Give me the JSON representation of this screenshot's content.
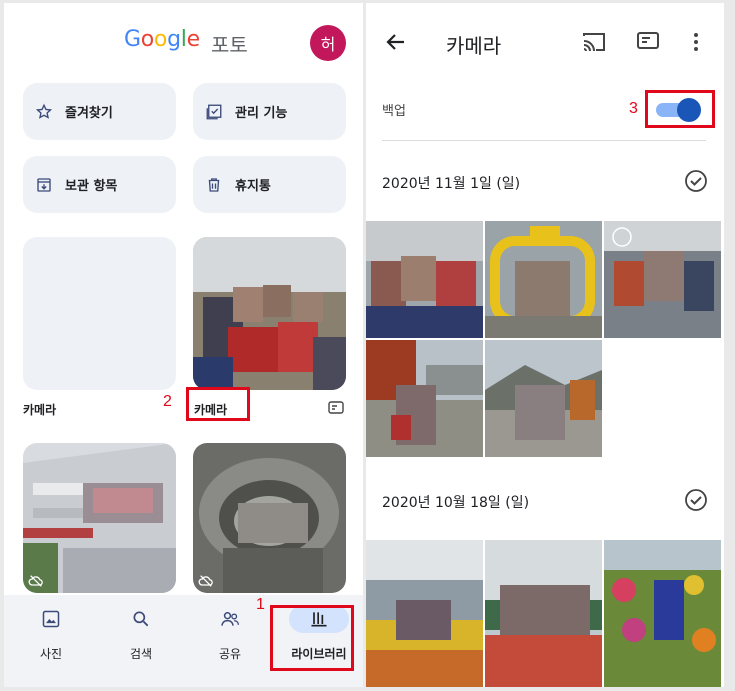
{
  "left": {
    "logo_letters": [
      "G",
      "o",
      "o",
      "g",
      "l",
      "e"
    ],
    "logo_suffix": "포토",
    "avatar_initial": "허",
    "quick_buttons": [
      {
        "label": "즐겨찾기",
        "icon": "star-icon"
      },
      {
        "label": "관리 기능",
        "icon": "checklist-icon"
      },
      {
        "label": "보관 항목",
        "icon": "archive-icon"
      },
      {
        "label": "휴지통",
        "icon": "trash-icon"
      }
    ],
    "albums": [
      {
        "label": "카메라"
      },
      {
        "label": "카메라"
      }
    ],
    "nav": [
      {
        "label": "사진",
        "icon": "photo-icon"
      },
      {
        "label": "검색",
        "icon": "search-icon"
      },
      {
        "label": "공유",
        "icon": "people-icon"
      },
      {
        "label": "라이브러리",
        "icon": "library-icon",
        "active": true
      }
    ],
    "annotations": [
      "1",
      "2"
    ]
  },
  "right": {
    "title": "카메라",
    "backup_label": "백업",
    "backup_on": true,
    "annotation": "3",
    "sections": [
      {
        "date": "2020년 11월 1일 (일)",
        "photo_count": 5
      },
      {
        "date": "2020년 10월 18일 (일)",
        "photo_count": 3
      }
    ]
  },
  "colors": {
    "annotation_red": "#e0081b",
    "accent_blue": "#1a56b8",
    "avatar_bg": "#c2185b"
  }
}
